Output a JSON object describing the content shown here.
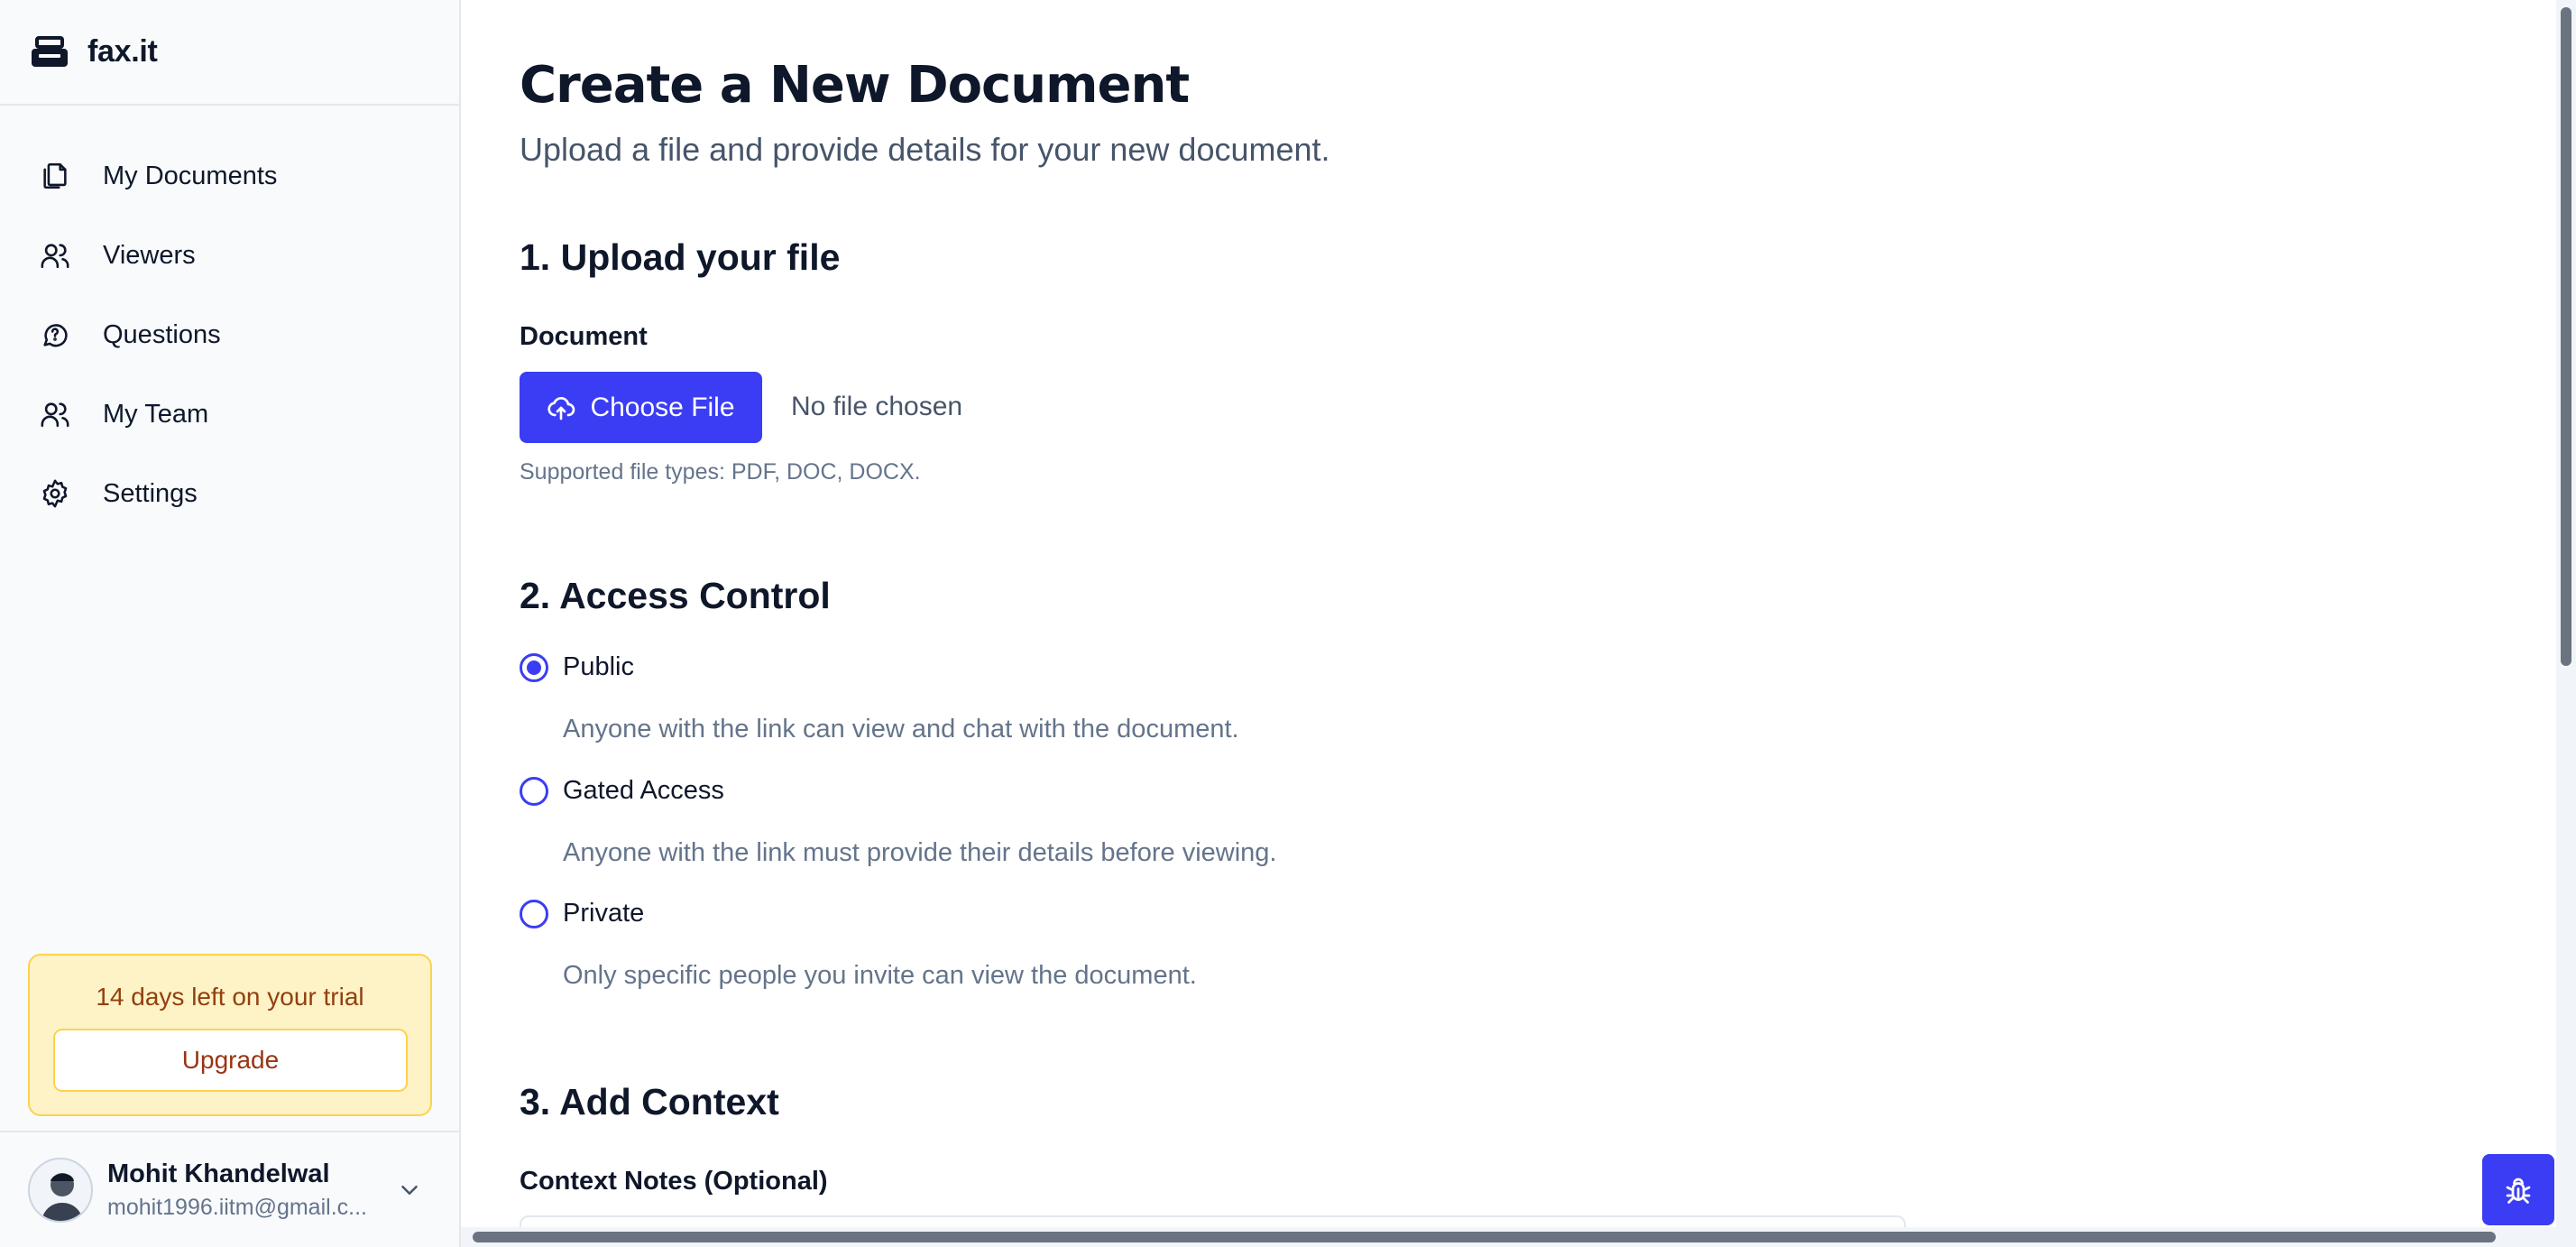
{
  "app": {
    "name": "fax.it"
  },
  "sidebar": {
    "items": [
      {
        "label": "My Documents",
        "icon": "documents-icon"
      },
      {
        "label": "Viewers",
        "icon": "users-icon"
      },
      {
        "label": "Questions",
        "icon": "chat-question-icon"
      },
      {
        "label": "My Team",
        "icon": "team-icon"
      },
      {
        "label": "Settings",
        "icon": "gear-icon"
      }
    ],
    "trial": {
      "text": "14 days left on your trial",
      "button": "Upgrade"
    },
    "user": {
      "name": "Mohit Khandelwal",
      "email": "mohit1996.iitm@gmail.c..."
    }
  },
  "main": {
    "title": "Create a New Document",
    "subtitle": "Upload a file and provide details for your new document.",
    "upload": {
      "heading": "1. Upload your file",
      "label": "Document",
      "button": "Choose File",
      "status": "No file chosen",
      "hint": "Supported file types: PDF, DOC, DOCX."
    },
    "access": {
      "heading": "2. Access Control",
      "options": [
        {
          "label": "Public",
          "description": "Anyone with the link can view and chat with the document.",
          "selected": true
        },
        {
          "label": "Gated Access",
          "description": "Anyone with the link must provide their details before viewing.",
          "selected": false
        },
        {
          "label": "Private",
          "description": "Only specific people you invite can view the document.",
          "selected": false
        }
      ]
    },
    "context": {
      "heading": "3. Add Context",
      "label": "Context Notes (Optional)"
    }
  },
  "colors": {
    "accent": "#3b3df4",
    "trial_bg": "#fef3c7",
    "trial_border": "#fcd34d",
    "trial_text": "#92400e"
  },
  "floating": {
    "icon": "bug-icon"
  }
}
